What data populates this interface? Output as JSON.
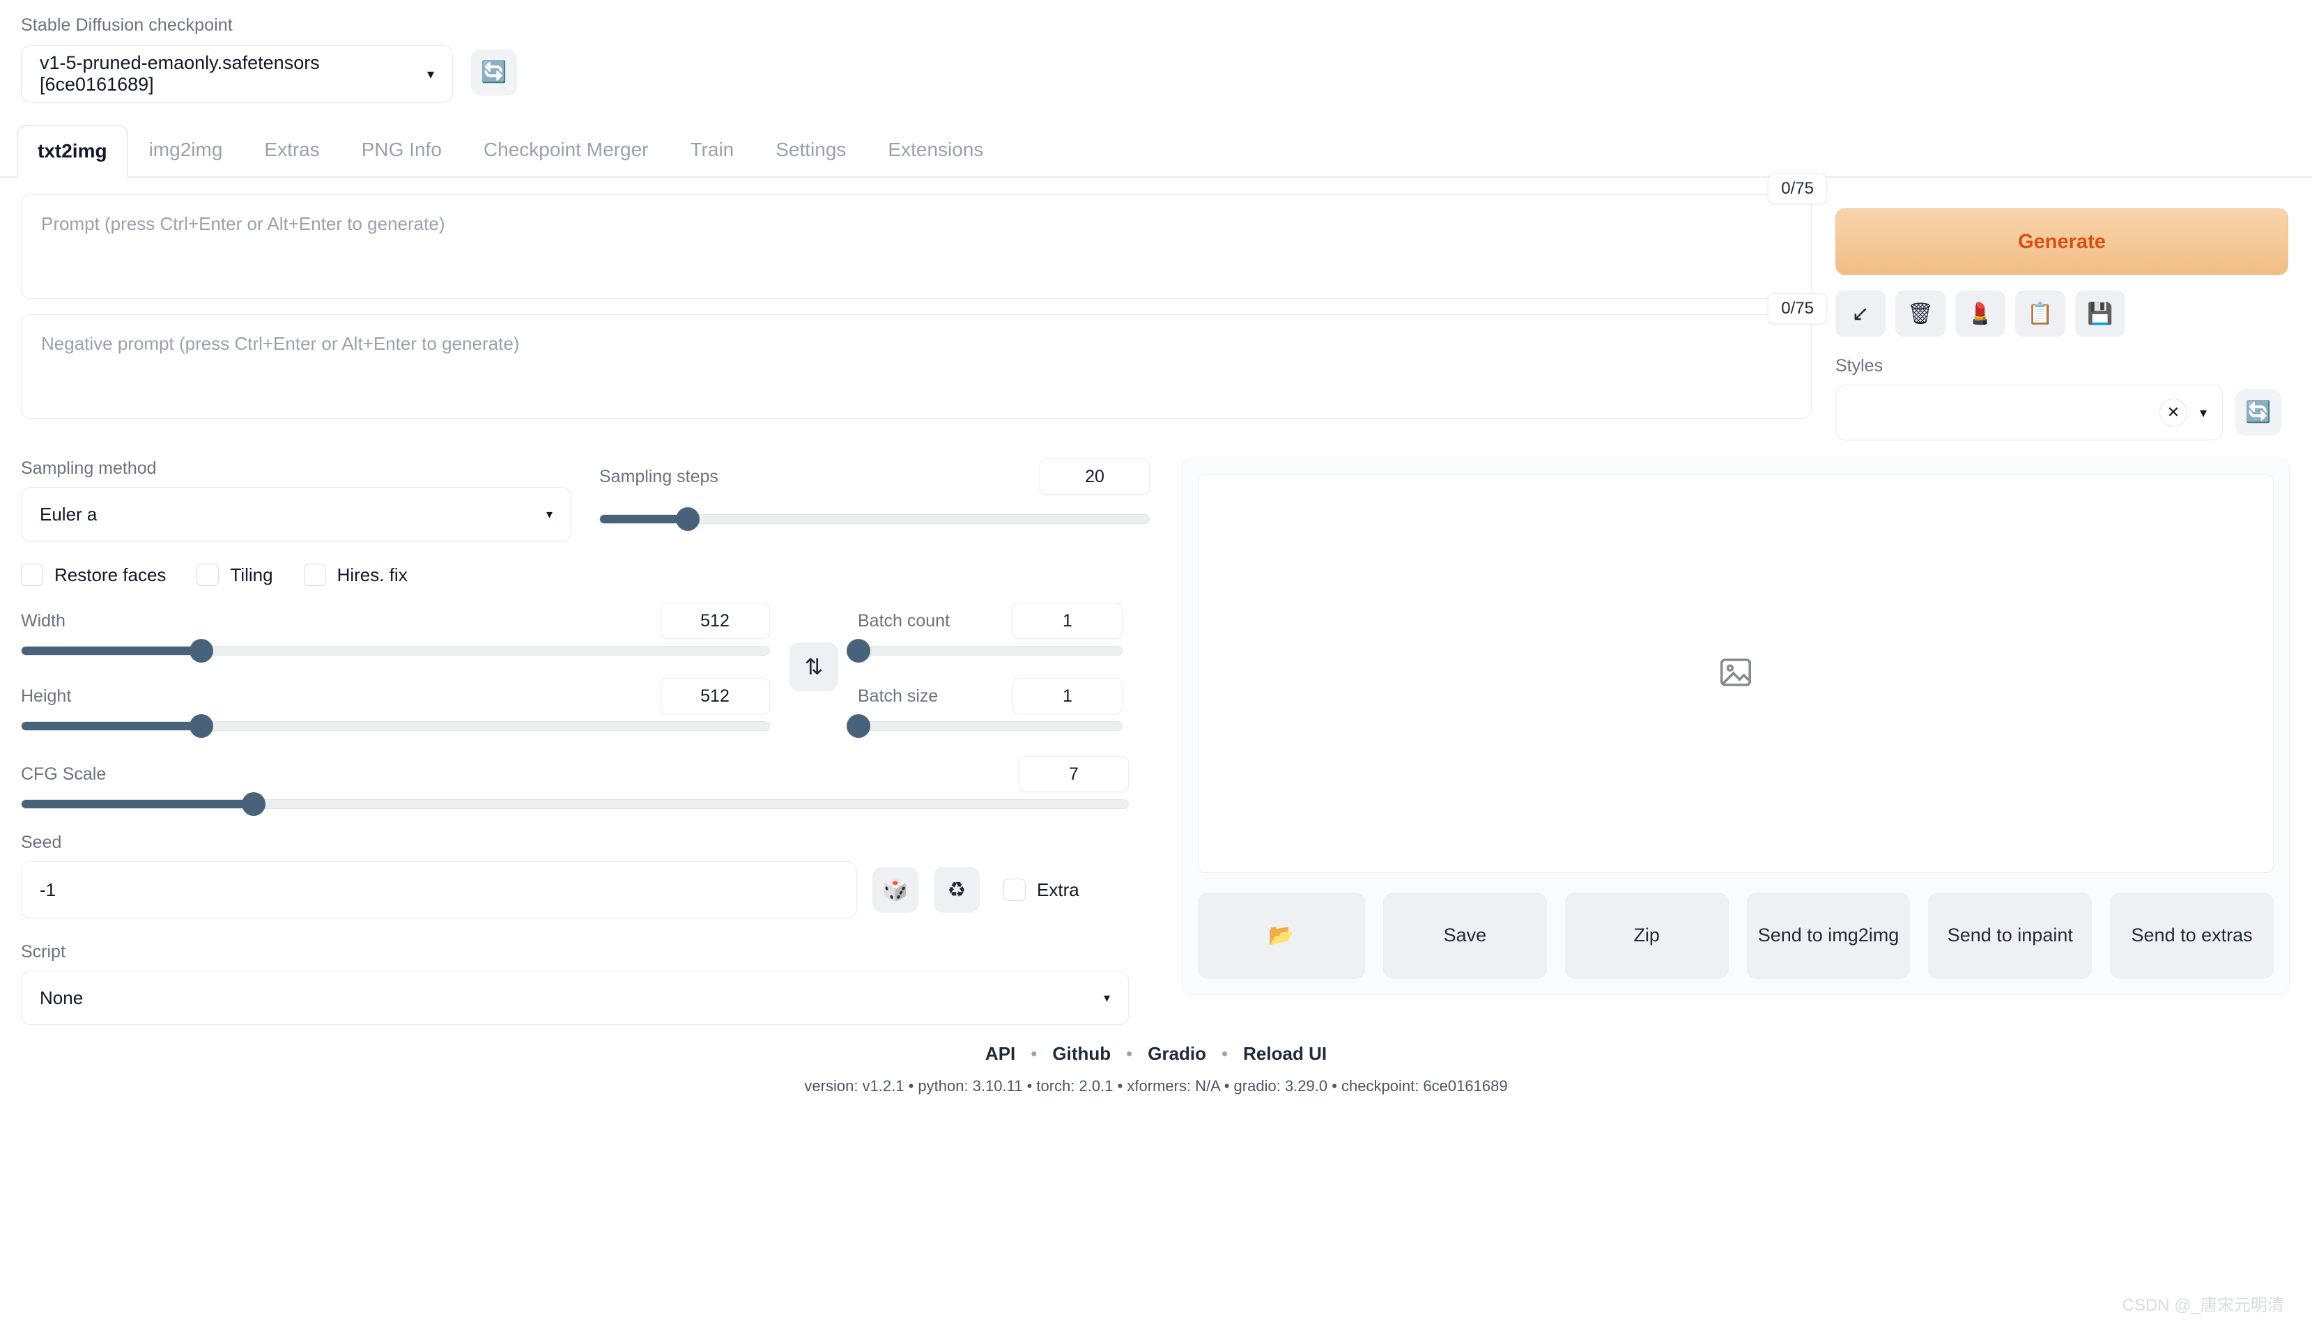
{
  "checkpoint": {
    "label": "Stable Diffusion checkpoint",
    "value": "v1-5-pruned-emaonly.safetensors [6ce0161689]",
    "caret": "▾",
    "refresh_icon": "🔄"
  },
  "tabs": [
    {
      "label": "txt2img",
      "active": true
    },
    {
      "label": "img2img",
      "active": false
    },
    {
      "label": "Extras",
      "active": false
    },
    {
      "label": "PNG Info",
      "active": false
    },
    {
      "label": "Checkpoint Merger",
      "active": false
    },
    {
      "label": "Train",
      "active": false
    },
    {
      "label": "Settings",
      "active": false
    },
    {
      "label": "Extensions",
      "active": false
    }
  ],
  "prompt": {
    "placeholder": "Prompt (press Ctrl+Enter or Alt+Enter to generate)",
    "value": "",
    "token_count": "0/75"
  },
  "negative_prompt": {
    "placeholder": "Negative prompt (press Ctrl+Enter or Alt+Enter to generate)",
    "value": "",
    "token_count": "0/75"
  },
  "generate": {
    "label": "Generate",
    "accent_color": "#d94f12",
    "bg_start": "#f8d5ab",
    "bg_end": "#f1bd86"
  },
  "tool_buttons": [
    {
      "name": "arrow-down-left-icon",
      "glyph": "↙"
    },
    {
      "name": "trash-icon",
      "glyph": "🗑"
    },
    {
      "name": "lipstick-icon",
      "glyph": "💄"
    },
    {
      "name": "clipboard-icon",
      "glyph": "📋"
    },
    {
      "name": "floppy-disk-icon",
      "glyph": "💾"
    }
  ],
  "styles": {
    "label": "Styles",
    "value": "",
    "clear_glyph": "✕",
    "caret": "▾",
    "refresh_icon": "🔄"
  },
  "sampling_method": {
    "label": "Sampling method",
    "value": "Euler a",
    "caret": "▾"
  },
  "sampling_steps": {
    "label": "Sampling steps",
    "value": "20",
    "fill_percent": 16
  },
  "checkboxes": [
    {
      "label": "Restore faces",
      "checked": false
    },
    {
      "label": "Tiling",
      "checked": false
    },
    {
      "label": "Hires. fix",
      "checked": false
    }
  ],
  "width": {
    "label": "Width",
    "value": "512",
    "fill_percent": 24
  },
  "height": {
    "label": "Height",
    "value": "512",
    "fill_percent": 24
  },
  "swap_button": {
    "name": "swap-dimensions-icon",
    "glyph": "⇅"
  },
  "batch_count": {
    "label": "Batch count",
    "value": "1",
    "fill_percent": 0
  },
  "batch_size": {
    "label": "Batch size",
    "value": "1",
    "fill_percent": 0
  },
  "cfg_scale": {
    "label": "CFG Scale",
    "value": "7",
    "fill_percent": 21
  },
  "seed": {
    "label": "Seed",
    "value": "-1",
    "dice_glyph": "🎲",
    "recycle_glyph": "♻",
    "extra_label": "Extra",
    "extra_checked": false
  },
  "script": {
    "label": "Script",
    "value": "None",
    "caret": "▾"
  },
  "output": {
    "placeholder_icon": "image-placeholder-icon",
    "buttons": [
      {
        "label": "",
        "icon": "📂",
        "name": "open-folder-button"
      },
      {
        "label": "Save",
        "icon": "",
        "name": "save-button"
      },
      {
        "label": "Zip",
        "icon": "",
        "name": "zip-button"
      },
      {
        "label": "Send to img2img",
        "icon": "",
        "name": "send-to-img2img-button"
      },
      {
        "label": "Send to inpaint",
        "icon": "",
        "name": "send-to-inpaint-button"
      },
      {
        "label": "Send to extras",
        "icon": "",
        "name": "send-to-extras-button"
      }
    ]
  },
  "footer": {
    "links": [
      "API",
      "Github",
      "Gradio",
      "Reload UI"
    ],
    "separator": "•",
    "version_line": "version: v1.2.1  •  python: 3.10.11  •  torch: 2.0.1  •  xformers: N/A  •  gradio: 3.29.0  •  checkpoint: 6ce0161689"
  },
  "watermark": "CSDN @_唐宋元明清"
}
